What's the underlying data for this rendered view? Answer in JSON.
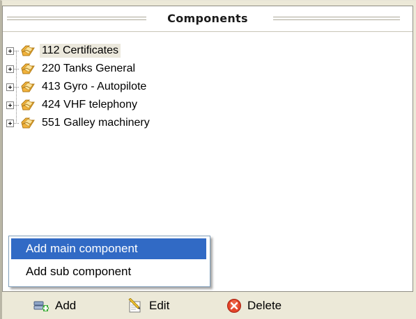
{
  "panel": {
    "title": "Components"
  },
  "tree": {
    "items": [
      {
        "code": "112",
        "label": "112  Certificates",
        "selected": true
      },
      {
        "code": "220",
        "label": "220  Tanks General",
        "selected": false
      },
      {
        "code": "413",
        "label": "413  Gyro - Autopilote",
        "selected": false
      },
      {
        "code": "424",
        "label": "424  VHF telephony",
        "selected": false
      },
      {
        "code": "551",
        "label": "551  Galley machinery",
        "selected": false
      }
    ],
    "icon": "folder-component-icon"
  },
  "context_menu": {
    "items": [
      {
        "label": "Add main component",
        "highlighted": true
      },
      {
        "label": "Add sub component",
        "highlighted": false
      }
    ]
  },
  "toolbar": {
    "add_label": "Add",
    "edit_label": "Edit",
    "delete_label": "Delete"
  },
  "colors": {
    "menu_highlight": "#316ac5",
    "toolbar_bg": "#ece9d8",
    "selected_node_bg": "#ebe8dc",
    "delete_icon": "#d9351f"
  }
}
